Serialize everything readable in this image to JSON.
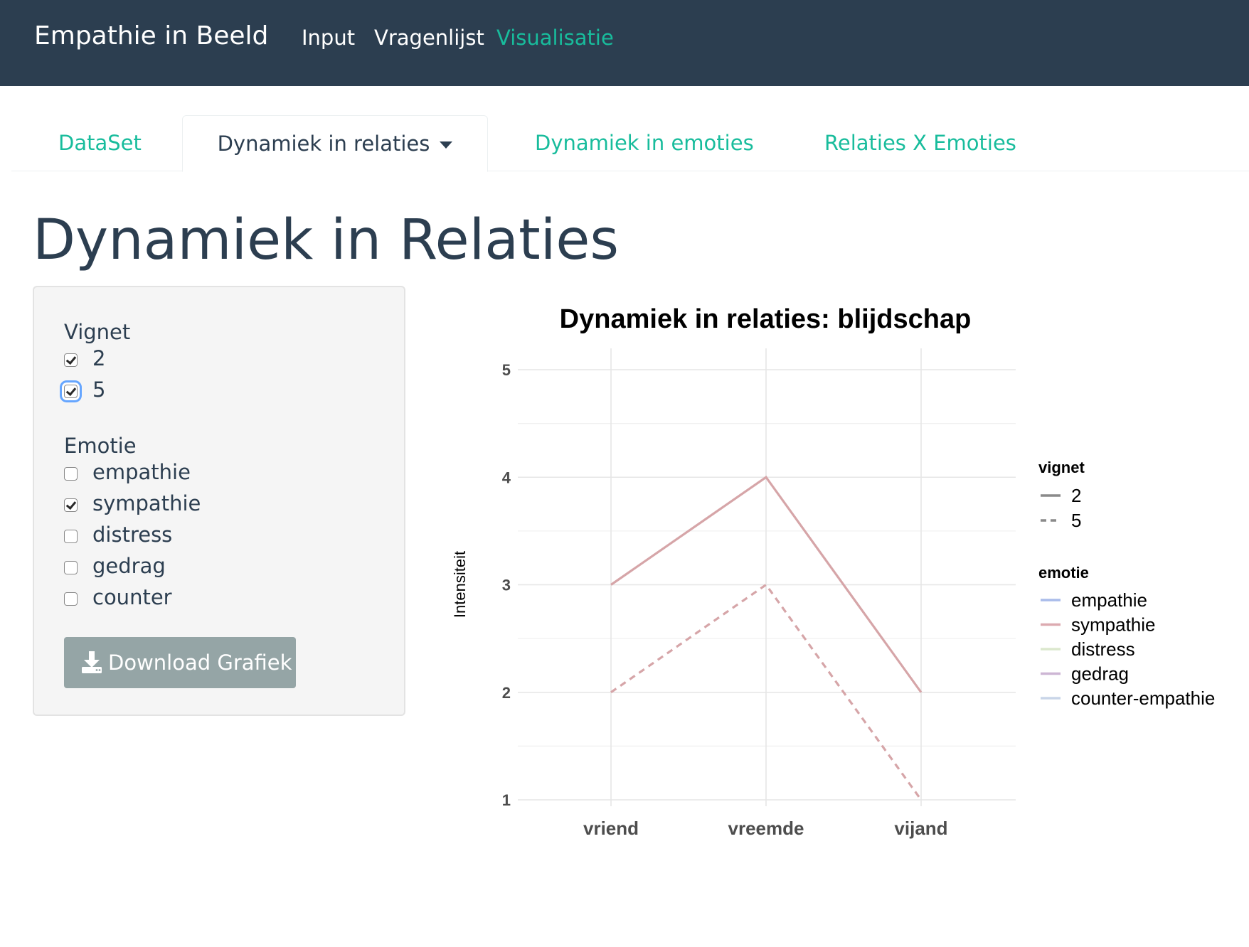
{
  "navbar": {
    "brand": "Empathie in Beeld",
    "links": [
      {
        "label": "Input",
        "active": false
      },
      {
        "label": "Vragenlijst",
        "active": false
      },
      {
        "label": "Visualisatie",
        "active": true
      }
    ]
  },
  "tabs": [
    {
      "label": "DataSet",
      "active": false
    },
    {
      "label": "Dynamiek in relaties",
      "active": true,
      "dropdown": true
    },
    {
      "label": "Dynamiek in emoties",
      "active": false
    },
    {
      "label": "Relaties X Emoties",
      "active": false
    }
  ],
  "page_title": "Dynamiek in Relaties",
  "sidebar": {
    "vignet_label": "Vignet",
    "vignet_options": [
      {
        "label": "2",
        "checked": true
      },
      {
        "label": "5",
        "checked": true,
        "focused": true
      }
    ],
    "emotie_label": "Emotie",
    "emotie_options": [
      {
        "label": "empathie",
        "checked": false
      },
      {
        "label": "sympathie",
        "checked": true
      },
      {
        "label": "distress",
        "checked": false
      },
      {
        "label": "gedrag",
        "checked": false
      },
      {
        "label": "counter",
        "checked": false
      }
    ],
    "download_label": "Download Grafiek",
    "download_icon": "download-icon"
  },
  "colors": {
    "navbar_bg": "#2c3e50",
    "accent": "#18bc9c",
    "button_bg": "#95a5a6",
    "sympathie_line": "#d6a5a8"
  },
  "chart_data": {
    "type": "line",
    "title": "Dynamiek in relaties: blijdschap",
    "xlabel": "",
    "ylabel": "Intensiteit",
    "categories": [
      "vriend",
      "vreemde",
      "vijand"
    ],
    "yticks": [
      1,
      2,
      3,
      4,
      5
    ],
    "ylim": [
      1,
      5
    ],
    "grid": true,
    "series": [
      {
        "vignet": "2",
        "emotie": "sympathie",
        "linestyle": "solid",
        "color": "#d6a5a8",
        "values": [
          3,
          4,
          2
        ]
      },
      {
        "vignet": "5",
        "emotie": "sympathie",
        "linestyle": "dashed",
        "color": "#d6a5a8",
        "values": [
          2,
          3,
          1
        ]
      }
    ],
    "legend": {
      "position": "right",
      "vignet_title": "vignet",
      "vignet_entries": [
        {
          "label": "2",
          "linestyle": "solid",
          "color": "#8a8a8a"
        },
        {
          "label": "5",
          "linestyle": "dashed",
          "color": "#8a8a8a"
        }
      ],
      "emotie_title": "emotie",
      "emotie_entries": [
        {
          "label": "empathie",
          "color": "#a9bcea"
        },
        {
          "label": "sympathie",
          "color": "#dcaab0"
        },
        {
          "label": "distress",
          "color": "#dce8cd"
        },
        {
          "label": "gedrag",
          "color": "#cdb6d4"
        },
        {
          "label": "counter-empathie",
          "color": "#c9d5e8"
        }
      ]
    }
  }
}
